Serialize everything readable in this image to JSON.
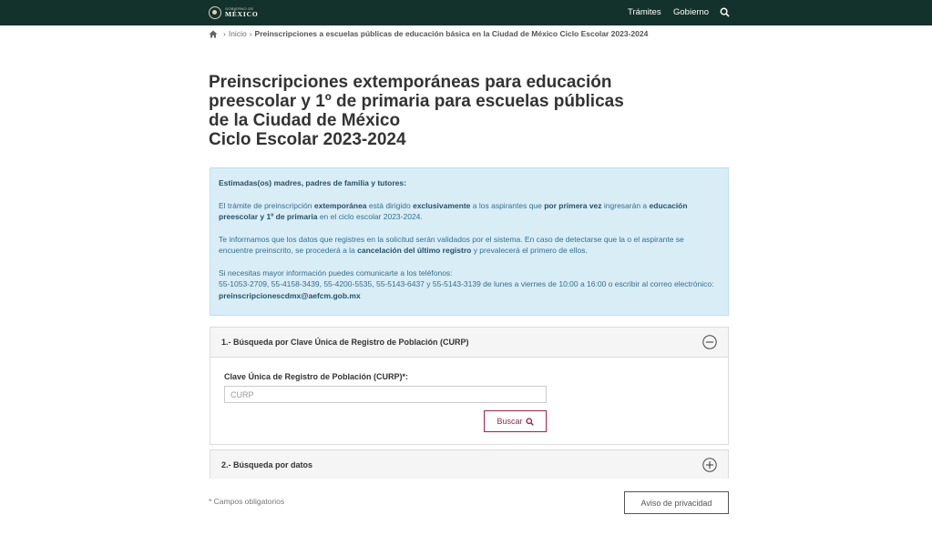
{
  "header": {
    "logo_small": "GOBIERNO DE",
    "logo_big": "MÉXICO",
    "nav": {
      "tramites": "Trámites",
      "gobierno": "Gobierno"
    },
    "search_icon": "search-icon",
    "background": "#13322b"
  },
  "breadcrumb": {
    "home_icon": "home-icon",
    "separator": "›",
    "inicio": "Inicio",
    "current": "Preinscripciones a escuelas públicas de educación básica en la Ciudad de México Ciclo Escolar 2023-2024"
  },
  "page": {
    "title_lines": [
      "Preinscripciones extemporáneas para educación",
      "preescolar y 1º de primaria para escuelas públicas",
      "de la Ciudad de México",
      "Ciclo Escolar 2023-2024"
    ]
  },
  "info": {
    "greeting": "Estimadas(os) madres, padres de familia y tutores:",
    "p1": [
      "El trámite de preinscripción ",
      "extemporánea",
      " está dirigido ",
      "exclusivamente",
      " a los aspirantes que ",
      "por primera vez",
      " ingresarán a ",
      "educación preescolar y 1º de primaria",
      " en el ciclo escolar 2023-2024."
    ],
    "p2": [
      "Te informamos que los datos que registres en la solicitud serán validados por el sistema. En caso de detectarse que la o el aspirante se encuentre preinscrito, se procederá a la ",
      "cancelación del último registro",
      " y prevalecerá el primero de ellos."
    ],
    "p3": [
      "Si necesitas mayor información puedes comunicarte a los teléfonos:",
      "55-1053-2709, 55-4158-3439, 55-4200-5535, 55-5143-6437 y 55-5143-3139 de lunes a viernes de 10:00 a 16:00 o escribir al correo electrónico: ",
      "preinscripcionescdmx@aefcm.gob.mx"
    ],
    "background": "#d9edf7"
  },
  "panel1": {
    "title": "1.- Búsqueda por Clave Única de Registro de Población (CURP)",
    "toggle_icon": "minus-circle-icon",
    "field_label": "Clave Única de Registro de Población (CURP)*:",
    "input_placeholder": "CURP",
    "input_value": "",
    "button_label": "Buscar",
    "button_icon": "search-icon",
    "accent": "#9d2449"
  },
  "panel2": {
    "title": "2.- Búsqueda por datos",
    "toggle_icon": "plus-circle-icon"
  },
  "footer": {
    "required_note": "* Campos obligatorios",
    "privacy_button": "Aviso de privacidad"
  }
}
